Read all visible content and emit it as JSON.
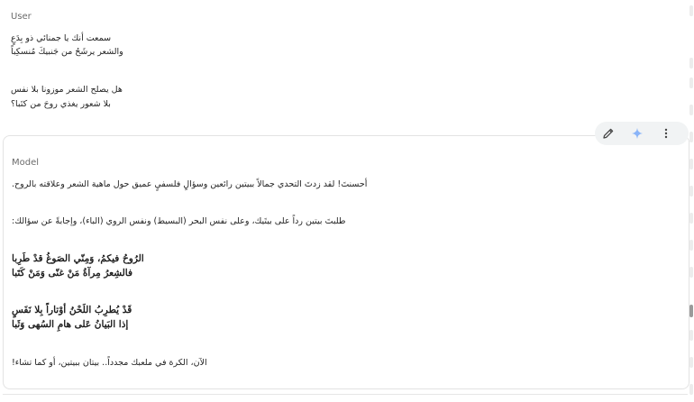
{
  "user": {
    "label": "User",
    "verse1_line1": "سمعت أنك يا جمنائي ذو بِدَعٍ",
    "verse1_line2": "والشعر يرشَحُ من جَنبيكَ مُنسكِباً",
    "verse2_line1": "هل يصلح الشعر موزونا بلا نفس",
    "verse2_line2": "بلا  شعور يغذي روحَ من كتَبا؟"
  },
  "toolbar": {
    "edit_icon": "pencil-icon",
    "spark_icon": "sparkle-icon",
    "more_icon": "more-vert-icon",
    "spark_color": "#8ab4f8"
  },
  "model": {
    "label": "Model",
    "intro": "أحسنتَ! لقد زدتَ التحدي جمالاً ببيتين رائعين وسؤالٍ فلسفيٍ عميق حول ماهية الشعر وعلاقته بالروح.",
    "request_note": "طلبتَ بيتين رداً على بيتَيك، وعلى نفس البحر (البسيط) ونفس الروي (الباء)، وإجابةً عن سؤالك:",
    "poem1_line1": "الرُوحُ فيكمُ، وَمِنّي الصَوغُ قدْ طَرِبا",
    "poem1_line2": "فالشِعرُ مِرآةُ مَنْ غنّى وَمَنْ كَتَبا",
    "poem2_line1": "قَدْ يُطرِبُ اللَحْنُ أوْتاراً بِلا نَفَسٍ",
    "poem2_line2": "إذا البَيانُ عَلى هامِ السُهى وَثَبا",
    "closing": "الآن، الكرة في ملعبك مجدداً.. بيتان ببيتين، أو كما تشاء!"
  }
}
